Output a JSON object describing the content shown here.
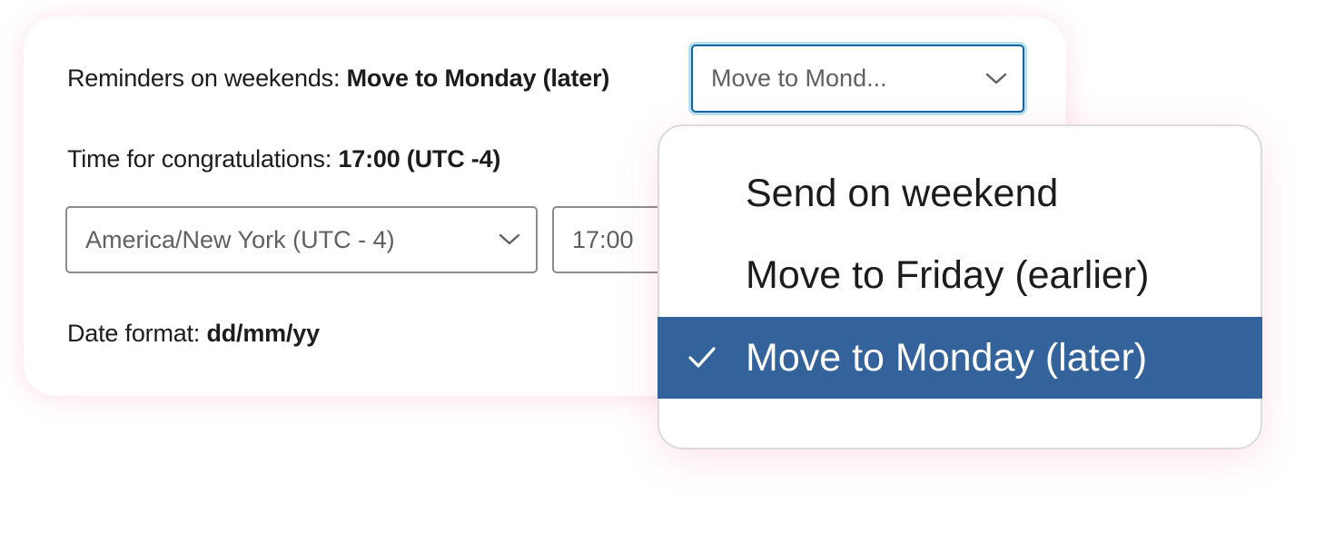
{
  "weekend_reminders": {
    "label": "Reminders on weekends:",
    "value": "Move to Monday (later)",
    "select_display": "Move to Mond..."
  },
  "congratulations_time": {
    "label": "Time for congratulations:",
    "value": "17:00 (UTC -4)",
    "timezone_select": "America/New York (UTC - 4)",
    "time_field": "17:00"
  },
  "date_format": {
    "label": "Date format:",
    "value": "dd/mm/yy"
  },
  "dropdown": {
    "options": [
      {
        "label": "Send on weekend",
        "selected": false
      },
      {
        "label": "Move to Friday (earlier)",
        "selected": false
      },
      {
        "label": "Move to Monday (later)",
        "selected": true
      }
    ]
  },
  "colors": {
    "selected_option_bg": "#34639c",
    "focus_border": "#1264a3",
    "card_glow": "#ec407a"
  },
  "icons": {
    "select_chevron": "chevron-down-icon",
    "selected_mark": "check-icon"
  }
}
